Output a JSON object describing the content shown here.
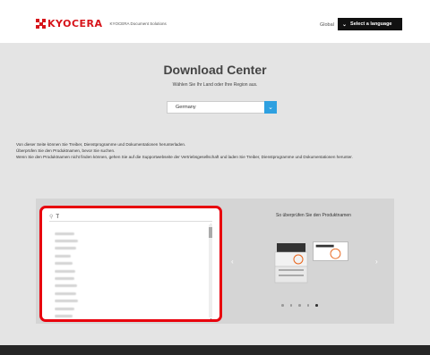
{
  "header": {
    "brand": "KYOCERA",
    "sub_brand": "KYOCERA Document Solutions",
    "global_link": "Global",
    "lang_button": "Select a language"
  },
  "main": {
    "title": "Download Center",
    "subtitle": "Wählen Sie Ihr Land oder Ihre Region aus.",
    "country": "Germany"
  },
  "info": {
    "line1": "Von dieser Seite können Sie Treiber, Dienstprogramme und Dokumentationen herunterladen.",
    "line2": "Überprüfen Sie den Produktnamen, bevor Sie suchen.",
    "line3": "Wenn Sie den Produktnamen nicht finden können, gehen Sie auf die Supportwebseite der Vertriebsgesellschaft und laden Sie Treiber, Dienstprogramme und Dokumentationen herunter."
  },
  "search": {
    "query": "T",
    "results_count_visible": 12
  },
  "carousel": {
    "title": "So überprüfen Sie den Produktnamen",
    "slide_count": 5,
    "active_index": 4
  },
  "colors": {
    "brand_red": "#d7141a",
    "highlight_red": "#e8000d",
    "accent_blue": "#2ea0e0"
  }
}
